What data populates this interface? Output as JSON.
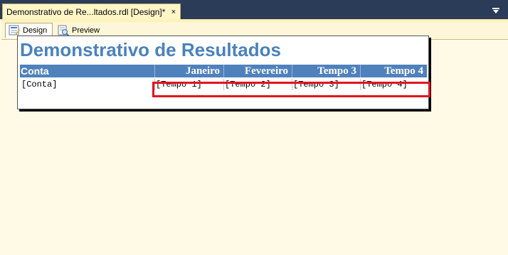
{
  "document_tab": {
    "title": "Demonstrativo de Re...ltados.rdl [Design]*",
    "close_glyph": "×"
  },
  "view_tabs": {
    "design": "Design",
    "preview": "Preview"
  },
  "report": {
    "title": "Demonstrativo de Resultados",
    "headers": [
      "Conta",
      "Janeiro",
      "Fevereiro",
      "Tempo 3",
      "Tempo 4"
    ],
    "cells": [
      "[Conta]",
      "[Tempo 1]",
      "[Tempo 2]",
      "[Tempo 3]",
      "[Tempo 4]"
    ]
  },
  "colors": {
    "header_blue": "#4f81bd",
    "title_blue": "#4a82bd",
    "highlight_red": "#e0141e",
    "canvas": "#fffae6",
    "tab_bg": "#fff6c8"
  },
  "icons": {
    "design": "design-view-icon",
    "preview": "preview-icon",
    "dropdown": "chevron-down-icon"
  }
}
